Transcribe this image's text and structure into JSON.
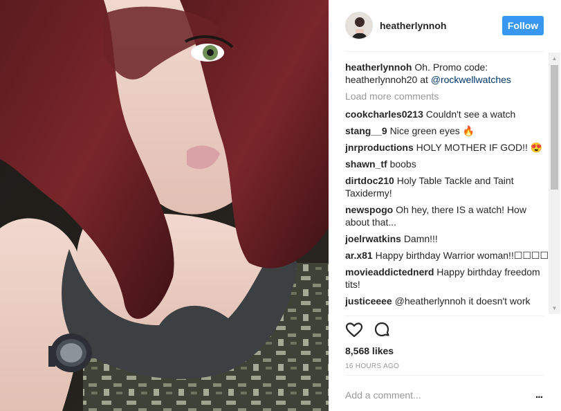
{
  "post": {
    "username": "heatherlynnoh",
    "follow_label": "Follow",
    "caption": {
      "user": "heatherlynnoh",
      "text": "Oh. Promo code: heatherlynnoh20 at ",
      "mention": "@rockwellwatches"
    },
    "load_more": "Load more comments",
    "comments": [
      {
        "user": "cookcharles0213",
        "text": "Couldn't see a watch"
      },
      {
        "user": "stang__9",
        "text": "Nice green eyes 🔥"
      },
      {
        "user": "jnrproductions",
        "text": "HOLY MOTHER IF GOD!! 😍"
      },
      {
        "user": "shawn_tf",
        "text": "boobs"
      },
      {
        "user": "dirtdoc210",
        "text": "Holy Table Tackle and Taint Taxidermy!"
      },
      {
        "user": "newspogo",
        "text": "Oh hey, there IS a watch! How about that..."
      },
      {
        "user": "joelrwatkins",
        "text": "Damn!!!"
      },
      {
        "user": "ar.x81",
        "text": "Happy birthday Warrior woman!!☐☐☐☐"
      },
      {
        "user": "movieaddictednerd",
        "text": "Happy birthday freedom tits!"
      },
      {
        "user": "justiceeee",
        "text": "@heatherlynnoh it doesn't work"
      }
    ],
    "likes": "8,568 likes",
    "time": "16 HOURS AGO",
    "comment_placeholder": "Add a comment...",
    "more_label": "..."
  },
  "icons": {
    "like": "heart-icon",
    "comment": "speech-bubble-icon",
    "options": "ellipsis-icon"
  },
  "colors": {
    "follow_button": "#3897f0",
    "mention": "#003569",
    "muted": "#999999"
  }
}
